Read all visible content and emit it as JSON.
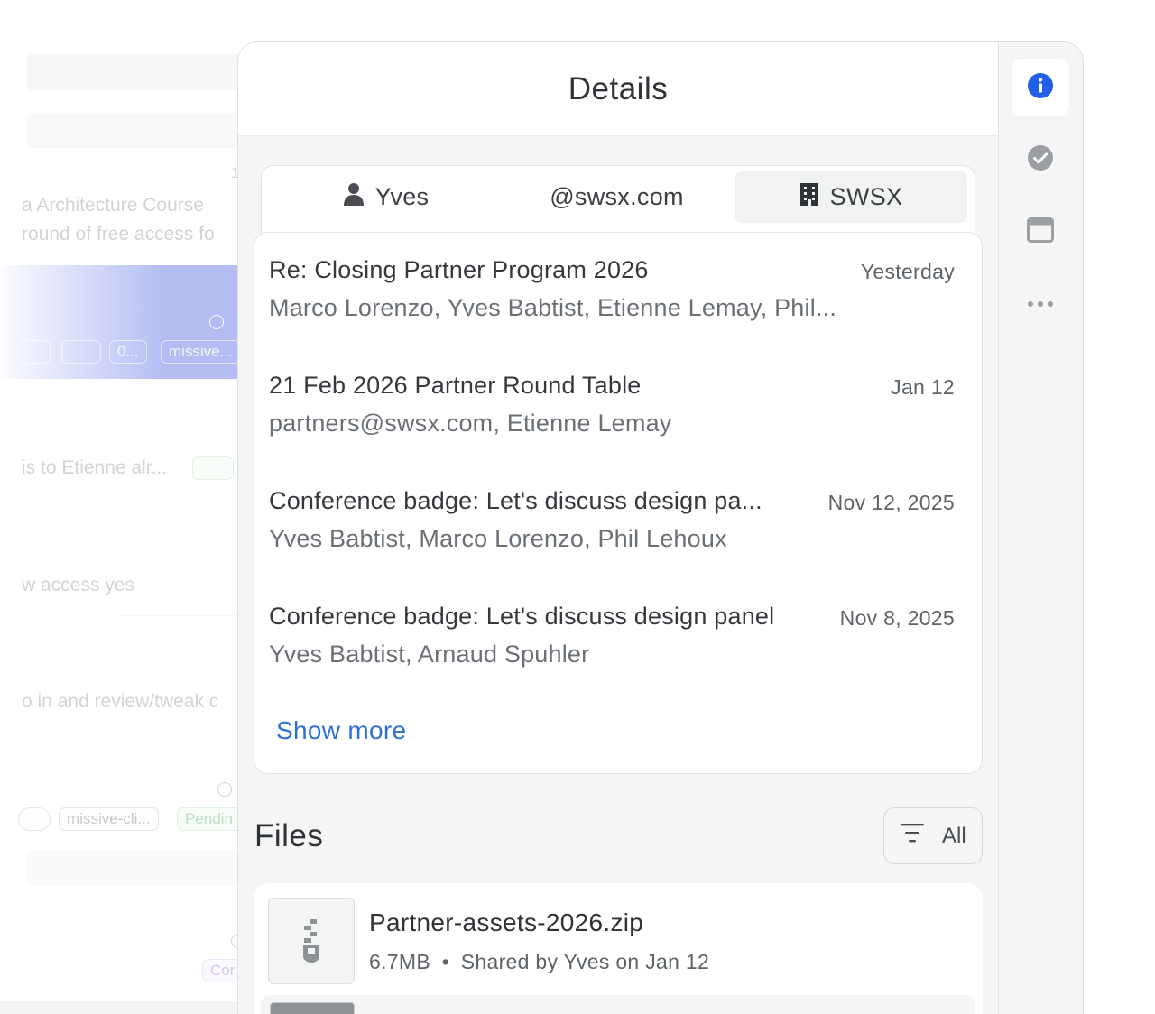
{
  "background": {
    "lines": [
      "a Architecture Course",
      "round of free access fo",
      "1",
      "is to Etienne alr...",
      "w access yes",
      "o in and review/tweak c"
    ],
    "chips": [
      "0...",
      "missive...",
      "missive-cli...",
      "Pendin",
      "Cor"
    ]
  },
  "panel": {
    "title": "Details",
    "rail": {
      "items": [
        "info-icon",
        "check-circle-icon",
        "window-icon",
        "more-icon"
      ],
      "active": "info-icon",
      "accent": "#2160e5"
    },
    "tabs": [
      {
        "label": "Yves",
        "icon": "person-icon"
      },
      {
        "label": "@swsx.com",
        "icon": ""
      },
      {
        "label": "SWSX",
        "icon": "building-icon"
      }
    ],
    "selected_tab": "SWSX",
    "threads": [
      {
        "subject": "Re: Closing Partner Program 2026",
        "date": "Yesterday",
        "participants": "Marco Lorenzo, Yves Babtist, Etienne Lemay, Phil..."
      },
      {
        "subject": "21 Feb 2026 Partner Round Table",
        "date": "Jan 12",
        "participants": "partners@swsx.com, Etienne Lemay"
      },
      {
        "subject": "Conference badge: Let's discuss design pa...",
        "date": "Nov 12, 2025",
        "participants": "Yves Babtist, Marco Lorenzo, Phil Lehoux"
      },
      {
        "subject": "Conference badge: Let's discuss design panel",
        "date": "Nov 8, 2025",
        "participants": "Yves Babtist, Arnaud Spuhler"
      }
    ],
    "show_more": "Show more",
    "files": {
      "title": "Files",
      "filter_label": "All",
      "items": [
        {
          "name": "Partner-assets-2026.zip",
          "size": "6.7MB",
          "separator": "•",
          "shared": "Shared by Yves on Jan 12",
          "icon": "zip-file-icon"
        }
      ]
    }
  }
}
